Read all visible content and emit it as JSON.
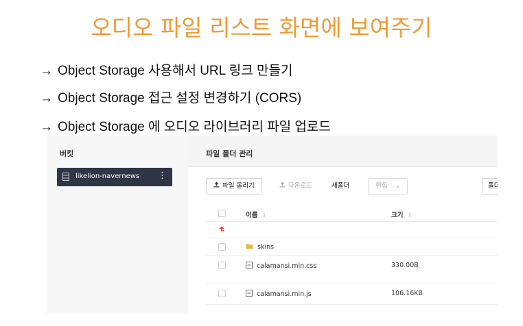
{
  "slide": {
    "title": "오디오 파일 리스트 화면에 보여주기",
    "bullets": [
      {
        "arrow": "→",
        "text": "Object Storage 사용해서 URL 링크 만들기"
      },
      {
        "arrow": "→",
        "text": "Object Storage 접근 설정 변경하기 (CORS)"
      },
      {
        "arrow": "→",
        "text": "Object Storage 에 오디오 라이브러리 파일 업로드"
      }
    ]
  },
  "colors": {
    "title": "#F39A33",
    "bucket_active_bg": "#2f3545",
    "up_arrow": "#e5432c",
    "folder": "#e8b84a"
  },
  "left_panel": {
    "title": "버킷",
    "bucket": {
      "icon": "bucket-icon",
      "label": "likelion-navernews",
      "more": "⋮"
    }
  },
  "right_panel": {
    "title": "파일 폴더 관리",
    "toolbar": {
      "upload": {
        "icon": "upload-icon",
        "label": "파일 올리기"
      },
      "download": {
        "icon": "download-icon",
        "label": "다운로드"
      },
      "new_folder": {
        "label": "새폴더"
      },
      "edit": {
        "label": "편집",
        "caret": "⌄"
      },
      "folder_right": {
        "label": "폴더"
      }
    },
    "table": {
      "headers": {
        "name": "이름",
        "size": "크기",
        "sort_icon": "⇕"
      },
      "up_icon": "↰",
      "rows": [
        {
          "icon": "folder-icon",
          "name": "skins",
          "size": ""
        },
        {
          "icon": "file-icon",
          "name": "calamansi.min.css",
          "size": "330.00B"
        },
        {
          "icon": "file-icon",
          "name": "calamansi.min.js",
          "size": "106.16KB"
        }
      ]
    }
  }
}
